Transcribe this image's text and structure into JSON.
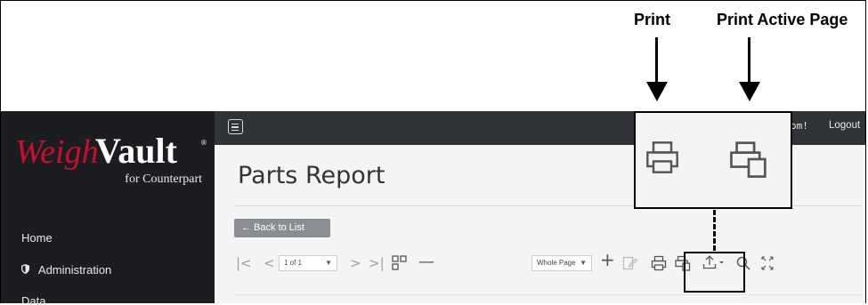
{
  "callouts": {
    "print": "Print",
    "print_active_page": "Print Active Page"
  },
  "brand": {
    "weigh": "Weigh",
    "vault": "Vault",
    "registered": "®",
    "tagline": "for Counterpart",
    "weigh_color": "#c8102e"
  },
  "sidebar": {
    "items": [
      {
        "label": "Home",
        "icon": ""
      },
      {
        "label": "Administration",
        "icon": "shield-icon"
      },
      {
        "label": "Data",
        "icon": ""
      }
    ]
  },
  "topbar": {
    "welcome_fragment": "om!",
    "logout": "Logout"
  },
  "page": {
    "title": "Parts Report",
    "back_button": "← Back to List"
  },
  "toolbar": {
    "page_indicator": "1 of 1",
    "zoom_mode": "Whole Page",
    "icons": [
      "first-page-icon",
      "prev-page-icon",
      "next-page-icon",
      "last-page-icon",
      "multipage-icon",
      "zoom-out-icon",
      "zoom-in-icon",
      "edit-icon",
      "print-icon",
      "print-active-page-icon",
      "export-icon",
      "search-icon",
      "fullscreen-icon"
    ]
  },
  "colors": {
    "sidebar_bg": "#1b1d21",
    "topbar_bg": "#2f3237",
    "content_bg": "#f4f4f4",
    "back_button_bg": "#8a8d91"
  }
}
